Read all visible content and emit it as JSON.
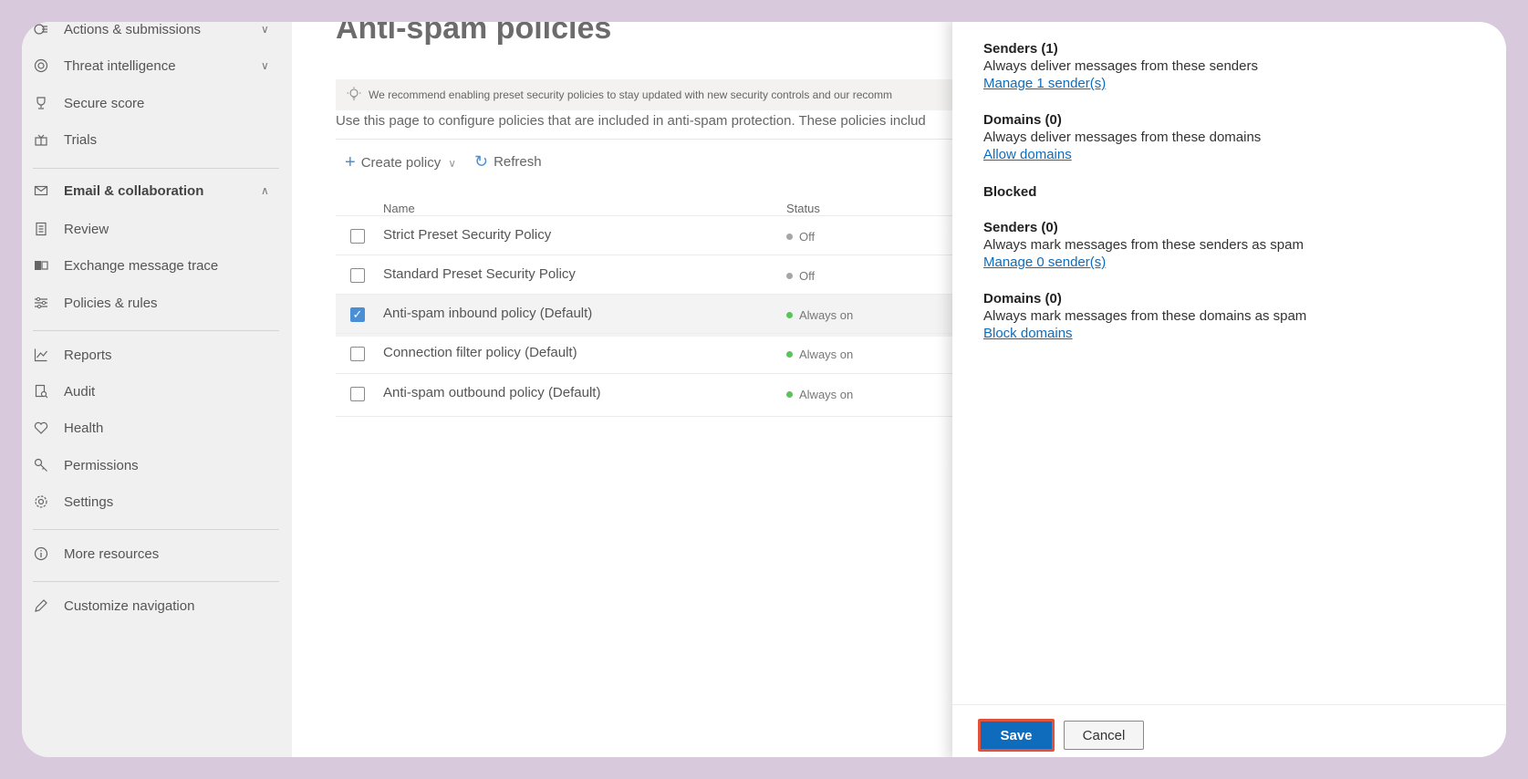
{
  "sidebar": {
    "items": [
      {
        "label": "Actions & submissions",
        "icon": "actions-icon",
        "chevron": "∨"
      },
      {
        "label": "Threat intelligence",
        "icon": "threat-icon",
        "chevron": "∨"
      },
      {
        "label": "Secure score",
        "icon": "trophy-icon"
      },
      {
        "label": "Trials",
        "icon": "gift-icon"
      },
      {
        "label": "Email & collaboration",
        "icon": "mail-icon",
        "chevron": "∧"
      },
      {
        "label": "Review",
        "icon": "review-icon"
      },
      {
        "label": "Exchange message trace",
        "icon": "exchange-icon"
      },
      {
        "label": "Policies & rules",
        "icon": "sliders-icon"
      },
      {
        "label": "Reports",
        "icon": "chart-icon"
      },
      {
        "label": "Audit",
        "icon": "audit-icon"
      },
      {
        "label": "Health",
        "icon": "heart-icon"
      },
      {
        "label": "Permissions",
        "icon": "key-icon"
      },
      {
        "label": "Settings",
        "icon": "gear-icon"
      },
      {
        "label": "More resources",
        "icon": "info-icon"
      },
      {
        "label": "Customize navigation",
        "icon": "pencil-icon"
      }
    ]
  },
  "main": {
    "title": "Anti-spam policies",
    "banner": "We recommend enabling preset security policies to stay updated with new security controls and our recomm",
    "description": "Use this page to configure policies that are included in anti-spam protection. These policies includ",
    "toolbar": {
      "create_label": "Create policy",
      "refresh_label": "Refresh"
    },
    "columns": {
      "name": "Name",
      "status": "Status"
    },
    "rows": [
      {
        "name": "Strict Preset Security Policy",
        "status": "Off",
        "checked": false
      },
      {
        "name": "Standard Preset Security Policy",
        "status": "Off",
        "checked": false
      },
      {
        "name": "Anti-spam inbound policy (Default)",
        "status": "Always on",
        "checked": true
      },
      {
        "name": "Connection filter policy (Default)",
        "status": "Always on",
        "checked": false
      },
      {
        "name": "Anti-spam outbound policy (Default)",
        "status": "Always on",
        "checked": false
      }
    ],
    "status_colors": {
      "off": "#a6a6a6",
      "on": "#5cc35c"
    }
  },
  "panel": {
    "allowed_senders": {
      "title": "Senders (1)",
      "text": "Always deliver messages from these senders",
      "link": "Manage 1 sender(s)"
    },
    "allowed_domains": {
      "title": "Domains (0)",
      "text": "Always deliver messages from these domains",
      "link": "Allow domains"
    },
    "blocked_heading": "Blocked",
    "blocked_senders": {
      "title": "Senders (0)",
      "text": "Always mark messages from these senders as spam",
      "link": "Manage 0 sender(s)"
    },
    "blocked_domains": {
      "title": "Domains (0)",
      "text": "Always mark messages from these domains as spam",
      "link": "Block domains"
    },
    "save_label": "Save",
    "cancel_label": "Cancel"
  },
  "colors": {
    "accent": "#0f6cbd",
    "highlight_border": "#e2513a",
    "frame": "#d8cadc"
  }
}
